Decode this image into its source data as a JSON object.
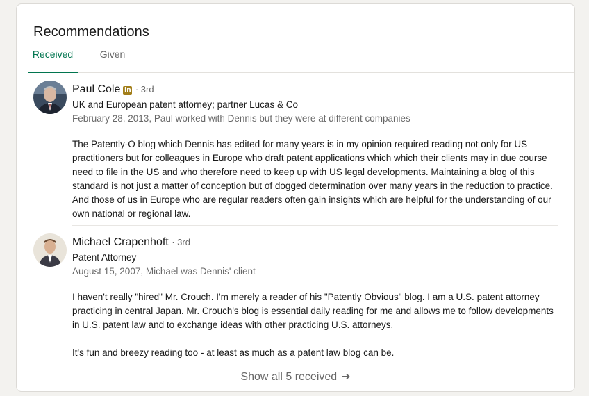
{
  "section": {
    "title": "Recommendations",
    "tabs": [
      {
        "label": "Received",
        "active": true
      },
      {
        "label": "Given",
        "active": false
      }
    ]
  },
  "recommendations": [
    {
      "name": "Paul Cole",
      "badge": "in",
      "degree": "· 3rd",
      "headline": "UK and European patent attorney; partner Lucas & Co",
      "meta": "February 28, 2013, Paul worked with Dennis but they were at different companies",
      "paragraphs": [
        "The Patently-O blog which Dennis has edited for many years is in my opinion required reading not only for US practitioners but for colleagues in Europe who draft patent applications which which their clients may in due course need to file in the US and who therefore need to keep up with US legal developments. Maintaining a blog of this standard is not just a matter of conception but of dogged determination over many years in the reduction to practice. And those of us in Europe who are regular readers often gain insights which are helpful for the understanding of our own national or regional law."
      ]
    },
    {
      "name": "Michael Crapenhoft",
      "degree": "· 3rd",
      "headline": "Patent Attorney",
      "meta": "August 15, 2007, Michael was Dennis' client",
      "paragraphs": [
        "I haven't really \"hired\" Mr. Crouch. I'm merely a reader of his \"Patently Obvious\" blog. I am a U.S. patent attorney practicing in central Japan. Mr. Crouch's blog is essential daily reading for me and allows me to follow developments in U.S. patent law and to exchange ideas with other practicing U.S. attorneys.",
        "It's fun and breezy reading too - at least as much as a patent law blog can be."
      ]
    }
  ],
  "footer": {
    "label": "Show all 5 received",
    "arrow_icon": "arrow-right-icon"
  },
  "colors": {
    "accent": "#01754f",
    "badge": "#a37f1b"
  }
}
